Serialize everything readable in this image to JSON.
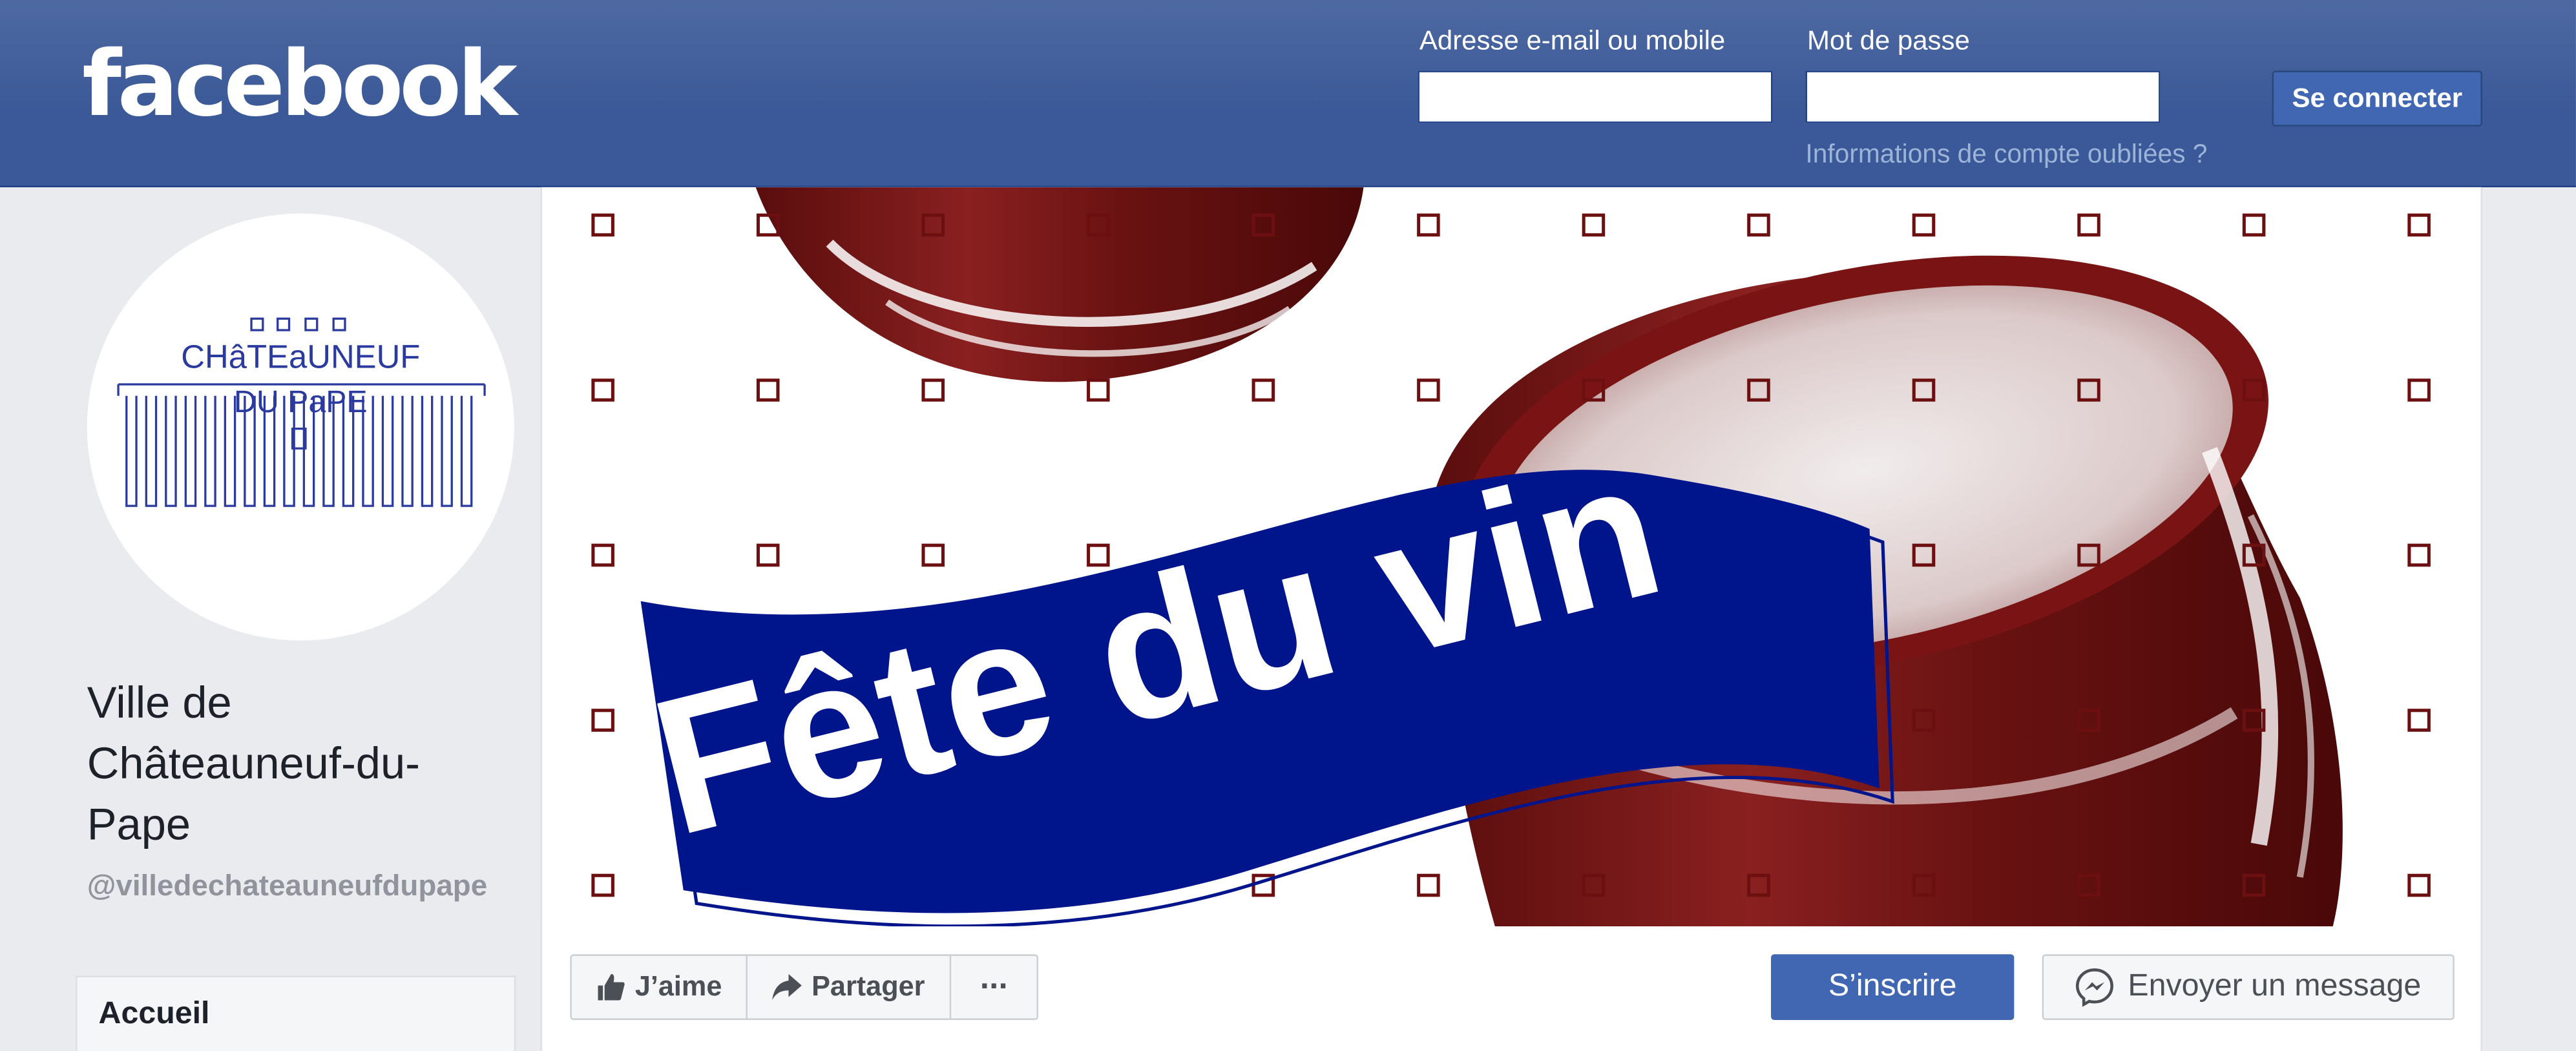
{
  "header": {
    "logo_text": "facebook",
    "email_label": "Adresse e-mail ou mobile",
    "email_value": "",
    "password_label": "Mot de passe",
    "password_value": "",
    "login_button": "Se connecter",
    "forgot_link": "Informations de compte oubliées ?"
  },
  "profile": {
    "logo_line1": "CHâTEaUNEUF",
    "logo_line2": "DU PaPE",
    "name": "Ville de Châteauneuf-du-Pape",
    "handle": "@villedechateauneufdupape"
  },
  "nav": {
    "items": [
      {
        "label": "Accueil"
      }
    ]
  },
  "cover": {
    "banner_text": "Fête du vin"
  },
  "actions": {
    "like": "J’aime",
    "share": "Partager",
    "more": "···",
    "subscribe": "S’inscrire",
    "message": "Envoyer un message"
  },
  "colors": {
    "facebook_blue": "#3b5998",
    "button_blue": "#4267b2",
    "banner_blue": "#00148c",
    "barrel_red": "#7a1818"
  }
}
